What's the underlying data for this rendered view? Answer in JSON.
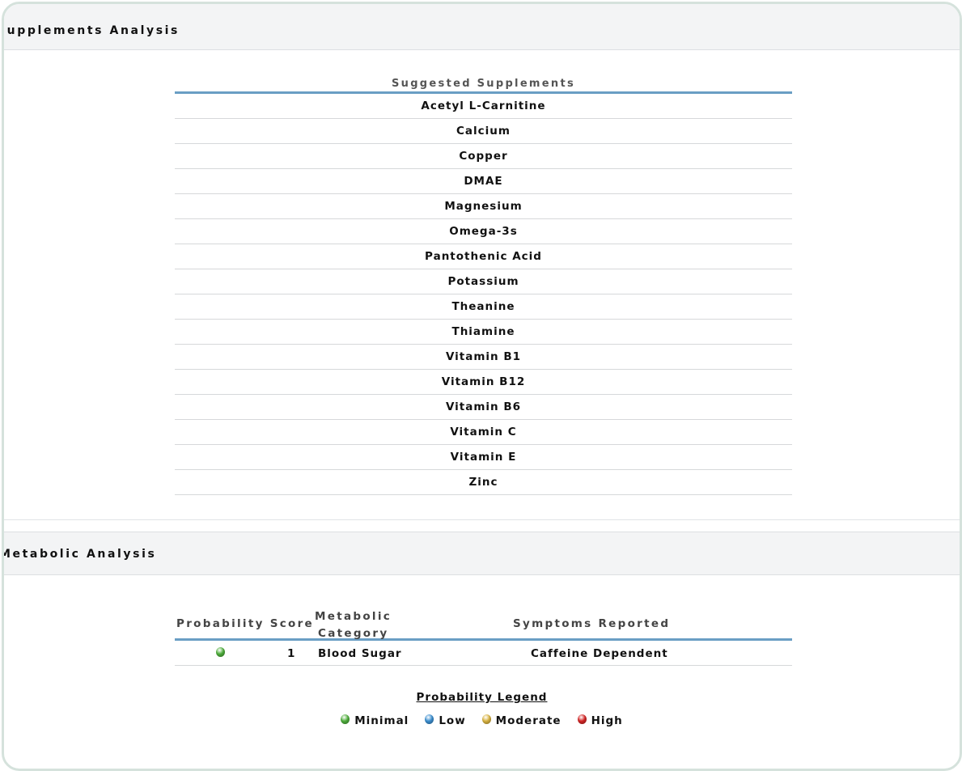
{
  "supplements_section": {
    "title": "Supplements Analysis",
    "table_header": "Suggested Supplements",
    "items": [
      "Acetyl L-Carnitine",
      "Calcium",
      "Copper",
      "DMAE",
      "Magnesium",
      "Omega-3s",
      "Pantothenic Acid",
      "Potassium",
      "Theanine",
      "Thiamine",
      "Vitamin B1",
      "Vitamin B12",
      "Vitamin B6",
      "Vitamin C",
      "Vitamin E",
      "Zinc"
    ]
  },
  "metabolic_section": {
    "title": "Metabolic Analysis",
    "headers": {
      "probability_score": "Probability Score",
      "category_line1": "Metabolic",
      "category_line2": "Category",
      "symptoms": "Symptoms Reported"
    },
    "rows": [
      {
        "probability": "minimal",
        "score": "1",
        "category": "Blood Sugar",
        "symptoms": "Caffeine Dependent"
      }
    ],
    "legend": {
      "title": "Probability Legend",
      "items": [
        {
          "label": "Minimal",
          "color": "#4fae3c",
          "icon": "green-orb-icon"
        },
        {
          "label": "Low",
          "color": "#3c8fd0",
          "icon": "blue-orb-icon"
        },
        {
          "label": "Moderate",
          "color": "#d9b341",
          "icon": "yellow-orb-icon"
        },
        {
          "label": "High",
          "color": "#d42626",
          "icon": "red-orb-icon"
        }
      ]
    }
  }
}
